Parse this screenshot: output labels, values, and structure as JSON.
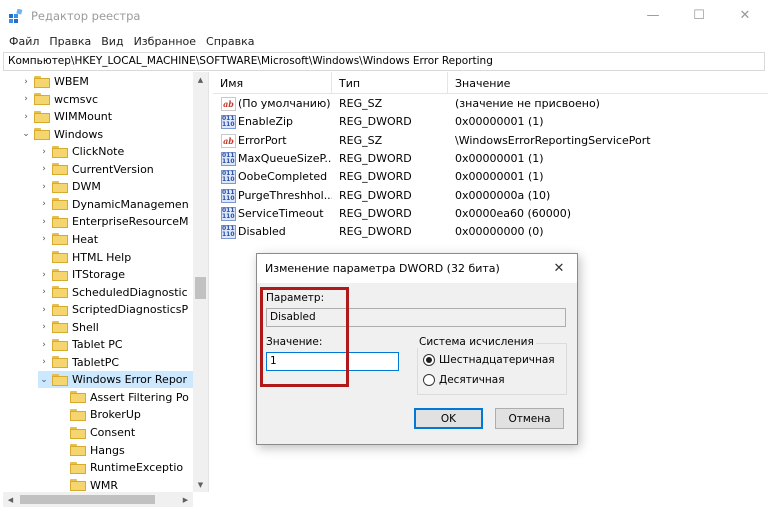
{
  "window": {
    "title": "Редактор реестра",
    "min_glyph": "—",
    "max_glyph": "☐",
    "close_glyph": "✕"
  },
  "menu": [
    "Файл",
    "Правка",
    "Вид",
    "Избранное",
    "Справка"
  ],
  "address": "Компьютер\\HKEY_LOCAL_MACHINE\\SOFTWARE\\Microsoft\\Windows\\Windows Error Reporting",
  "tree": [
    {
      "label": "WBEM",
      "level": 0,
      "exp": ">"
    },
    {
      "label": "wcmsvc",
      "level": 0,
      "exp": ">"
    },
    {
      "label": "WIMMount",
      "level": 0,
      "exp": ">"
    },
    {
      "label": "Windows",
      "level": 0,
      "exp": "v"
    },
    {
      "label": "ClickNote",
      "level": 1,
      "exp": ">"
    },
    {
      "label": "CurrentVersion",
      "level": 1,
      "exp": ">"
    },
    {
      "label": "DWM",
      "level": 1,
      "exp": ">"
    },
    {
      "label": "DynamicManagemen",
      "level": 1,
      "exp": ">"
    },
    {
      "label": "EnterpriseResourceM",
      "level": 1,
      "exp": ">"
    },
    {
      "label": "Heat",
      "level": 1,
      "exp": ">"
    },
    {
      "label": "HTML Help",
      "level": 1,
      "exp": ""
    },
    {
      "label": "ITStorage",
      "level": 1,
      "exp": ">"
    },
    {
      "label": "ScheduledDiagnostic",
      "level": 1,
      "exp": ">"
    },
    {
      "label": "ScriptedDiagnosticsP",
      "level": 1,
      "exp": ">"
    },
    {
      "label": "Shell",
      "level": 1,
      "exp": ">"
    },
    {
      "label": "Tablet PC",
      "level": 1,
      "exp": ">"
    },
    {
      "label": "TabletPC",
      "level": 1,
      "exp": ">"
    },
    {
      "label": "Windows Error Repor",
      "level": 1,
      "exp": "v",
      "selected": true
    },
    {
      "label": "Assert Filtering Po",
      "level": 2,
      "exp": ""
    },
    {
      "label": "BrokerUp",
      "level": 2,
      "exp": ""
    },
    {
      "label": "Consent",
      "level": 2,
      "exp": ""
    },
    {
      "label": "Hangs",
      "level": 2,
      "exp": ""
    },
    {
      "label": "RuntimeExceptio",
      "level": 2,
      "exp": ""
    },
    {
      "label": "WMR",
      "level": 2,
      "exp": ""
    }
  ],
  "list": {
    "columns": [
      "Имя",
      "Тип",
      "Значение"
    ],
    "rows": [
      {
        "icon": "ab",
        "name": "(По умолчанию)",
        "type": "REG_SZ",
        "value": "(значение не присвоено)"
      },
      {
        "icon": "bin",
        "name": "EnableZip",
        "type": "REG_DWORD",
        "value": "0x00000001 (1)"
      },
      {
        "icon": "ab",
        "name": "ErrorPort",
        "type": "REG_SZ",
        "value": "\\WindowsErrorReportingServicePort"
      },
      {
        "icon": "bin",
        "name": "MaxQueueSizeP...",
        "type": "REG_DWORD",
        "value": "0x00000001 (1)"
      },
      {
        "icon": "bin",
        "name": "OobeCompleted",
        "type": "REG_DWORD",
        "value": "0x00000001 (1)"
      },
      {
        "icon": "bin",
        "name": "PurgeThreshhol...",
        "type": "REG_DWORD",
        "value": "0x0000000a (10)"
      },
      {
        "icon": "bin",
        "name": "ServiceTimeout",
        "type": "REG_DWORD",
        "value": "0x0000ea60 (60000)"
      },
      {
        "icon": "bin",
        "name": "Disabled",
        "type": "REG_DWORD",
        "value": "0x00000000 (0)"
      }
    ]
  },
  "dialog": {
    "title": "Изменение параметра DWORD (32 бита)",
    "close_glyph": "✕",
    "param_label": "Параметр:",
    "param_value": "Disabled",
    "value_label": "Значение:",
    "value_input": "1",
    "base_title": "Система исчисления",
    "radio_hex": "Шестнадцатеричная",
    "radio_dec": "Десятичная",
    "ok": "OK",
    "cancel": "Отмена"
  }
}
